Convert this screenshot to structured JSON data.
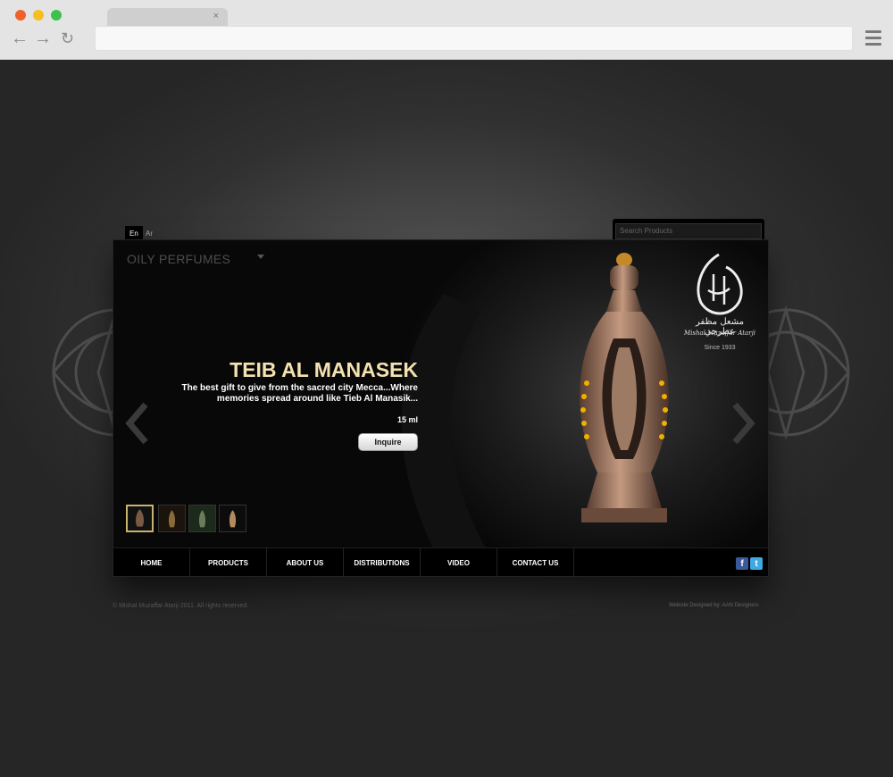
{
  "browser": {
    "tab_close": "×",
    "back": "←",
    "forward": "→",
    "reload": "↻"
  },
  "lang": {
    "en": "En",
    "ar": "Ar"
  },
  "search": {
    "placeholder": "Search Products"
  },
  "category": "OILY PERFUMES",
  "product": {
    "title": "TEIB AL MANASEK",
    "description": "The best gift to give from the sacred city Mecca...Where memories spread around like Tieb Al Manasik...",
    "size": "15 ml",
    "inquire_label": "Inquire"
  },
  "brand": {
    "arabic": "مشعل مظفر عطرجي",
    "name": "Mishal Muzaffar Atarji",
    "since": "Since 1933"
  },
  "nav": {
    "items": [
      "HOME",
      "PRODUCTS",
      "ABOUT US",
      "DISTRIBUTIONS",
      "VIDEO",
      "CONTACT US"
    ]
  },
  "social": {
    "facebook": "f",
    "twitter": "t"
  },
  "footer": {
    "copyright": "© Mishal Muzaffar Atarji 2011. All rights reserved.",
    "credit": "Website Designed by: AAN Designers"
  },
  "colors": {
    "title": "#f4e2b0",
    "accent_gold": "#c9b26d",
    "facebook": "#3b5998",
    "twitter": "#3fa9e0"
  }
}
